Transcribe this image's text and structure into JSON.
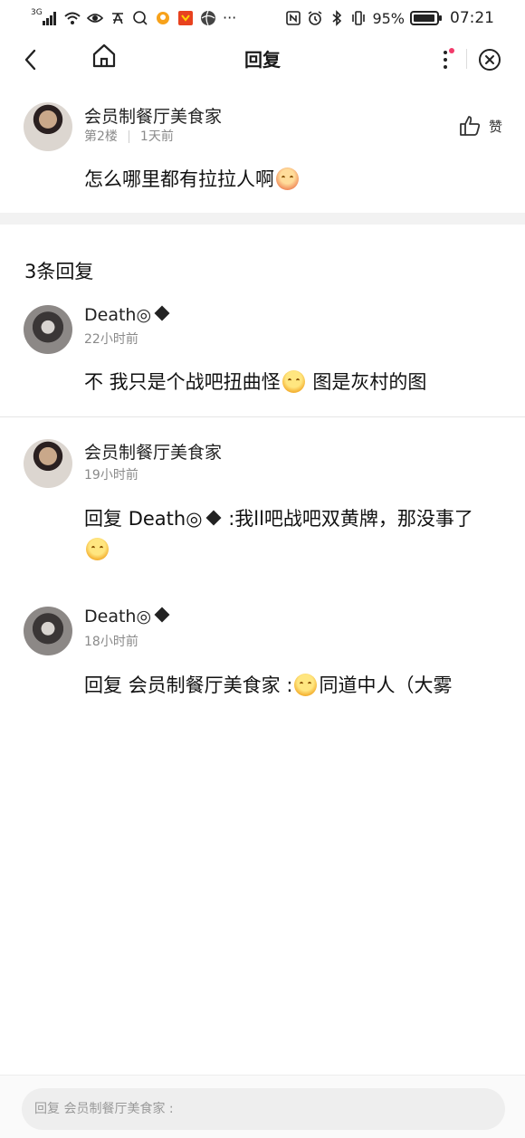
{
  "status_bar": {
    "network": "3G",
    "battery_percent": "95%",
    "battery_level": 0.95,
    "time": "07:21"
  },
  "nav": {
    "title": "回复"
  },
  "main_post": {
    "username": "会员制餐厅美食家",
    "floor": "第2楼",
    "time": "1天前",
    "content": "怎么哪里都有拉拉人啊",
    "like_label": "赞"
  },
  "replies_count_label": "3条回复",
  "replies": [
    {
      "username": "Death◎",
      "time": "22小时前",
      "content_before": "不 我只是个战吧扭曲怪",
      "content_after": " 图是灰村的图"
    },
    {
      "username": "会员制餐厅美食家",
      "time": "19小时前",
      "prefix": "回复 ",
      "mention": "Death◎",
      "content": " :我ll吧战吧双黄牌，那没事了"
    },
    {
      "username": "Death◎",
      "time": "18小时前",
      "prefix": "回复 ",
      "mention": "会员制餐厅美食家",
      "content": " :",
      "content_after": "同道中人（大雾"
    }
  ],
  "reply_input": {
    "placeholder": "回复 会员制餐厅美食家 :"
  }
}
